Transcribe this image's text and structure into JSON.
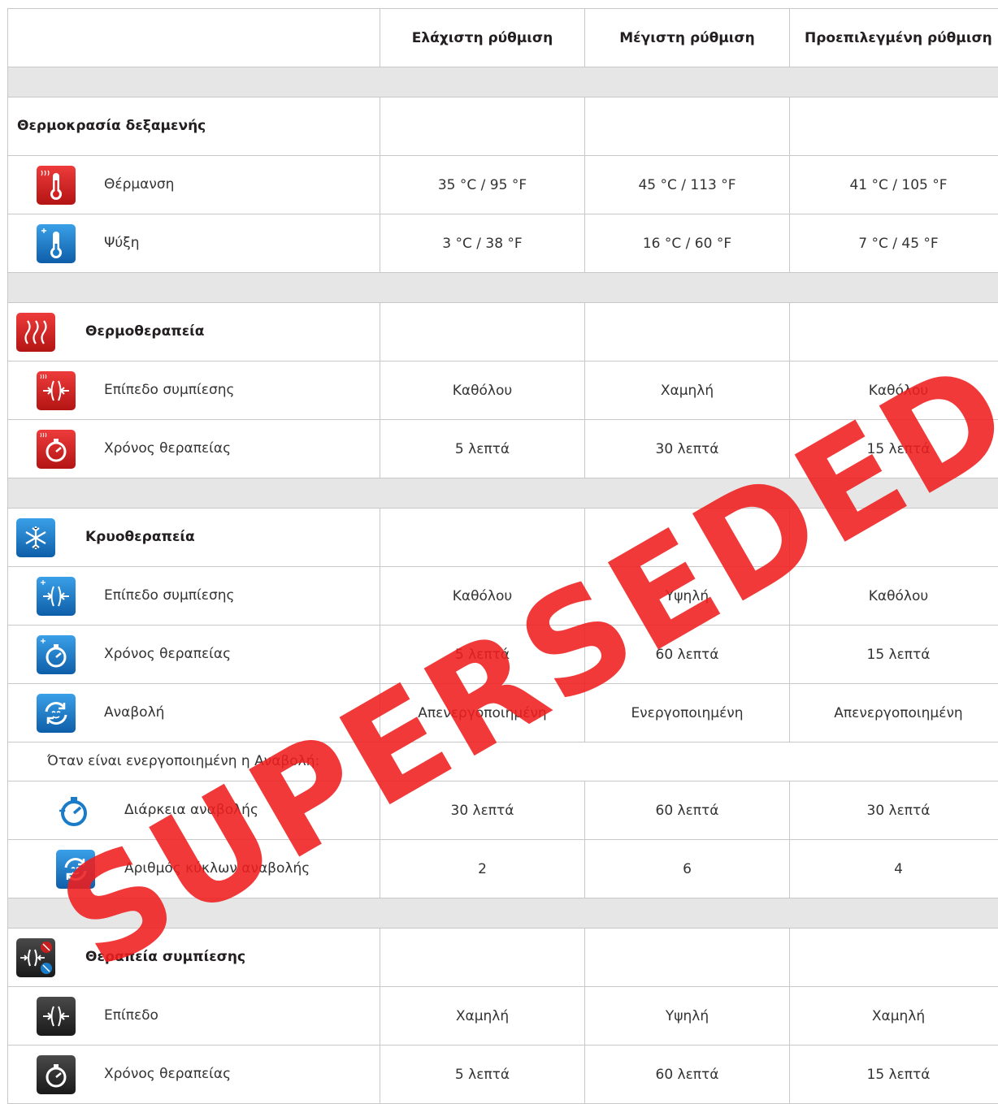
{
  "columns": {
    "min": "Ελάχιστη ρύθμιση",
    "max": "Μέγιστη ρύθμιση",
    "default": "Προεπιλεγμένη ρύθμιση"
  },
  "tank": {
    "title": "Θερμοκρασία δεξαμενής",
    "heating": {
      "label": "Θέρμανση",
      "min": "35 °C / 95 °F",
      "max": "45 °C / 113 °F",
      "default": "41 °C / 105 °F"
    },
    "cooling": {
      "label": "Ψύξη",
      "min": "3 °C / 38 °F",
      "max": "16 °C / 60 °F",
      "default": "7 °C / 45 °F"
    }
  },
  "heat": {
    "title": "Θερμοθεραπεία",
    "compression": {
      "label": "Επίπεδο συμπίεσης",
      "min": "Καθόλου",
      "max": "Χαμηλή",
      "default": "Καθόλου"
    },
    "time": {
      "label": "Χρόνος θεραπείας",
      "min": "5 λεπτά",
      "max": "30 λεπτά",
      "default": "15 λεπτά"
    }
  },
  "cryo": {
    "title": "Κρυοθεραπεία",
    "compression": {
      "label": "Επίπεδο συμπίεσης",
      "min": "Καθόλου",
      "max": "Υψηλή",
      "default": "Καθόλου"
    },
    "time": {
      "label": "Χρόνος θεραπείας",
      "min": "5 λεπτά",
      "max": "60 λεπτά",
      "default": "15 λεπτά"
    },
    "snooze": {
      "label": "Αναβολή",
      "min": "Απενεργοποιημένη",
      "max": "Ενεργοποιημένη",
      "default": "Απενεργοποιημένη"
    },
    "snooze_note": "Όταν είναι ενεργοποιημένη η Αναβολή:",
    "snooze_duration": {
      "label": "Διάρκεια αναβολής",
      "min": "30 λεπτά",
      "max": "60 λεπτά",
      "default": "30 λεπτά"
    },
    "snooze_cycles": {
      "label": "Αριθμός κύκλων αναβολής",
      "min": "2",
      "max": "6",
      "default": "4"
    }
  },
  "compression": {
    "title": "Θεραπεία συμπίεσης",
    "level": {
      "label": "Επίπεδο",
      "min": "Χαμηλή",
      "max": "Υψηλή",
      "default": "Χαμηλή"
    },
    "time": {
      "label": "Χρόνος θεραπείας",
      "min": "5 λεπτά",
      "max": "60 λεπτά",
      "default": "15 λεπτά"
    }
  },
  "watermark": "SUPERSEDED",
  "colors": {
    "red": "#d42020",
    "blue": "#1a7cc8",
    "dark": "#2a2a2a",
    "grey_band": "#e6e6e6",
    "watermark": "#f01e1e"
  },
  "icons": {
    "heating": "thermometer-heat-icon",
    "cooling": "thermometer-cold-icon",
    "heat_therapy": "heat-waves-icon",
    "heat_compression": "compression-heat-icon",
    "heat_timer": "timer-heat-icon",
    "cryo_therapy": "snowflake-icon",
    "cryo_compression": "compression-cold-icon",
    "cryo_timer": "timer-cold-icon",
    "snooze": "snooze-icon",
    "snooze_duration": "stopwatch-icon",
    "snooze_cycles": "snooze-cycles-icon",
    "compression_therapy": "compression-therapy-icon",
    "compression_level": "compression-level-icon",
    "compression_timer": "timer-dark-icon"
  }
}
